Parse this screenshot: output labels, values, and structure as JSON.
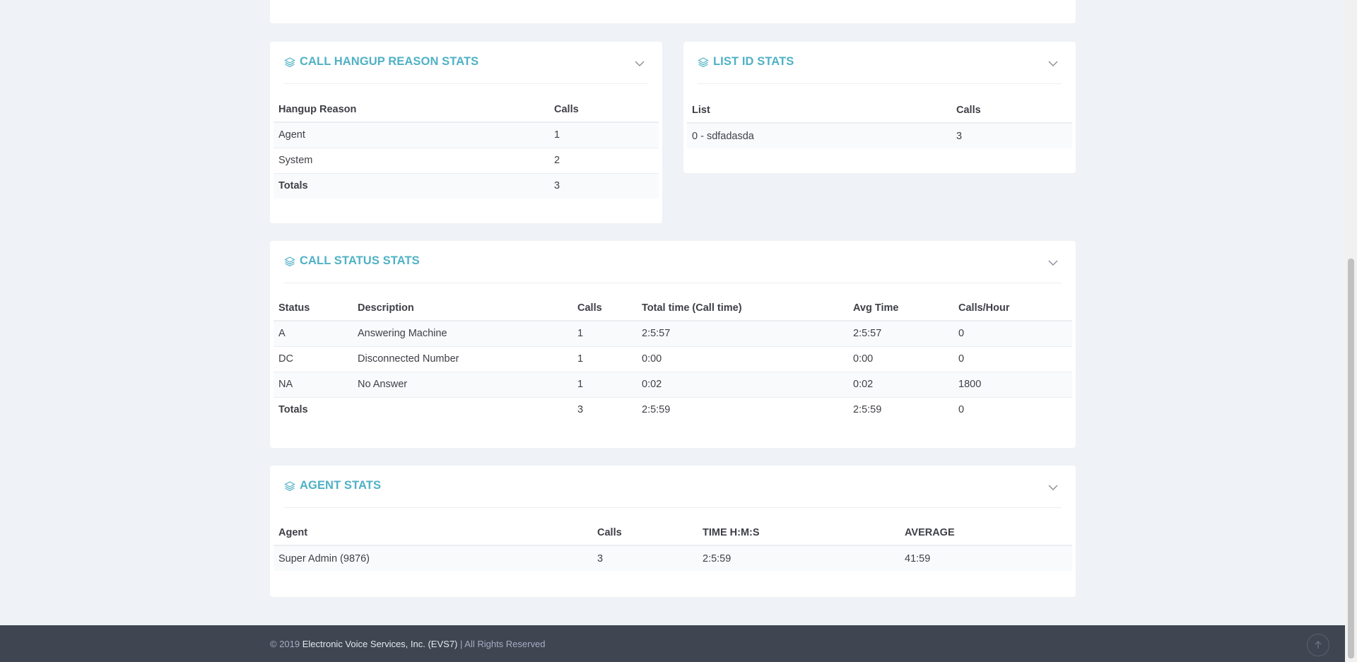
{
  "hangup_stats": {
    "title": "CALL HANGUP REASON STATS",
    "headers": [
      "Hangup Reason",
      "Calls"
    ],
    "rows": [
      [
        "Agent",
        "1"
      ],
      [
        "System",
        "2"
      ]
    ],
    "totals": [
      "Totals",
      "3"
    ]
  },
  "list_stats": {
    "title": "LIST ID STATS",
    "headers": [
      "List",
      "Calls"
    ],
    "rows": [
      [
        "0 - sdfadasda",
        "3"
      ]
    ]
  },
  "status_stats": {
    "title": "CALL STATUS STATS",
    "headers": [
      "Status",
      "Description",
      "Calls",
      "Total time (Call time)",
      "Avg Time",
      "Calls/Hour"
    ],
    "rows": [
      [
        "A",
        "Answering Machine",
        "1",
        "2:5:57",
        "2:5:57",
        "0"
      ],
      [
        "DC",
        "Disconnected Number",
        "1",
        "0:00",
        "0:00",
        "0"
      ],
      [
        "NA",
        "No Answer",
        "1",
        "0:02",
        "0:02",
        "1800"
      ]
    ],
    "totals": [
      "Totals",
      "",
      "3",
      "2:5:59",
      "2:5:59",
      "0"
    ]
  },
  "agent_stats": {
    "title": "AGENT STATS",
    "headers": [
      "Agent",
      "Calls",
      "TIME H:M:S",
      "AVERAGE"
    ],
    "rows": [
      [
        "Super Admin (9876)",
        "3",
        "2:5:59",
        "41:59"
      ]
    ]
  },
  "footer": {
    "prefix": "© 2019 ",
    "company": "Electronic Voice Services, Inc. (EVS7)",
    "suffix": " | All Rights Reserved"
  },
  "colors": {
    "accent": "#4fb1c5",
    "background": "#eff2f6",
    "footer": "#3f4651"
  }
}
